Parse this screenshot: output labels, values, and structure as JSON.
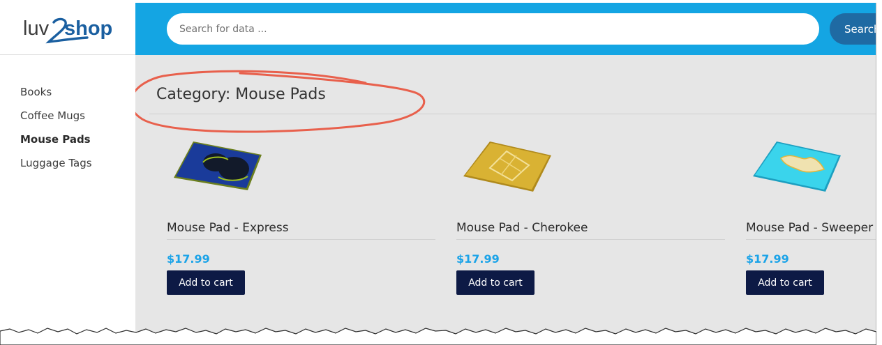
{
  "brand": {
    "logo_text_left": "luv",
    "logo_text_right": "shop"
  },
  "sidebar": {
    "items": [
      {
        "label": "Books",
        "active": false
      },
      {
        "label": "Coffee Mugs",
        "active": false
      },
      {
        "label": "Mouse Pads",
        "active": true
      },
      {
        "label": "Luggage Tags",
        "active": false
      }
    ]
  },
  "search": {
    "placeholder": "Search for data ...",
    "value": "",
    "button_label": "Search"
  },
  "main": {
    "title": "Category: Mouse Pads"
  },
  "products": [
    {
      "name": "Mouse Pad - Express",
      "price": "$17.99",
      "button_label": "Add to cart",
      "image_icon": "mouse-pad-blue-fractal-image"
    },
    {
      "name": "Mouse Pad - Cherokee",
      "price": "$17.99",
      "button_label": "Add to cart",
      "image_icon": "mouse-pad-gold-fractal-image"
    },
    {
      "name": "Mouse Pad - Sweeper",
      "price": "$17.99",
      "button_label": "Add to cart",
      "image_icon": "mouse-pad-cyan-fractal-image"
    }
  ],
  "colors": {
    "header": "#14a5e3",
    "search_button": "#1f6aa3",
    "price": "#1aa3e8",
    "cart_button": "#0d1a45",
    "annotation": "#e8604c",
    "main_bg": "#e6e6e6"
  }
}
